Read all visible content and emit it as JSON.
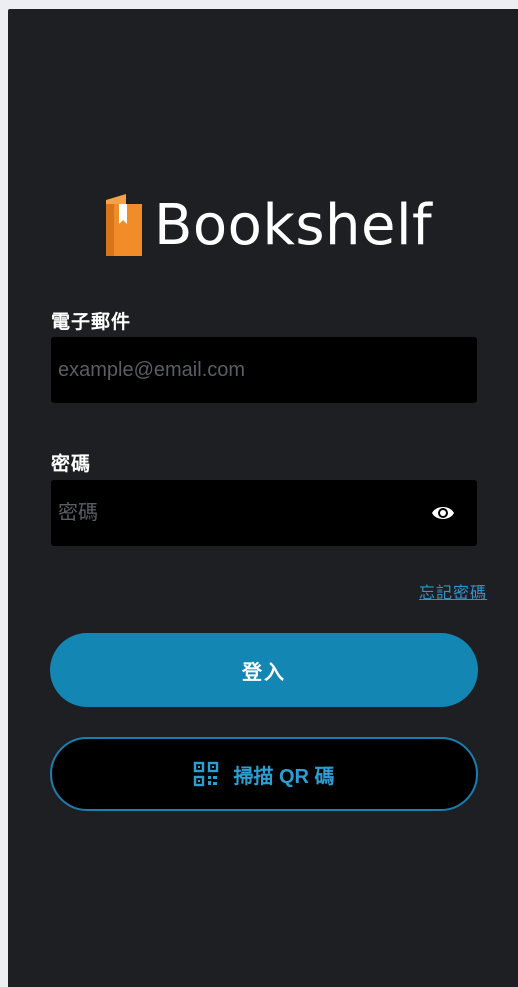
{
  "app": {
    "name": "Bookshelf",
    "logo_icon": "bookmark-book-icon",
    "logo_color": "#f28c28"
  },
  "form": {
    "email": {
      "label": "電子郵件",
      "placeholder": "example@email.com",
      "value": ""
    },
    "password": {
      "label": "密碼",
      "placeholder": "密碼",
      "value": "",
      "toggle_icon": "eye-icon"
    },
    "forgot_password": "忘記密碼"
  },
  "actions": {
    "login_label": "登入",
    "scan_qr_label": "掃描 QR 碼",
    "scan_qr_icon": "qr-code-icon"
  },
  "colors": {
    "background": "#1e1f22",
    "input_bg": "#000000",
    "primary": "#1386b4",
    "link": "#2f95c8",
    "text": "#ffffff"
  }
}
